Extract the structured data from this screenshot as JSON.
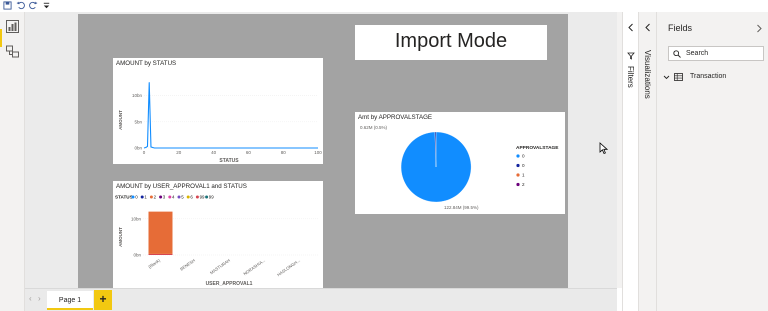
{
  "quick_access": {
    "items": [
      "save-icon",
      "undo-icon",
      "redo-icon",
      "customize-icon"
    ]
  },
  "rail": {
    "items": [
      "report-view-icon",
      "model-view-icon"
    ]
  },
  "report": {
    "title": "Import Mode",
    "chart1": {
      "title": "AMOUNT by STATUS",
      "xlabel": "STATUS",
      "ylabel": "AMOUNT",
      "y_ticks": [
        "10bn",
        "5bn",
        "0bn"
      ],
      "x_ticks": [
        "0",
        "20",
        "40",
        "60",
        "80",
        "100"
      ]
    },
    "chart2": {
      "title": "Amt by APPROVALSTAGE",
      "label_top": "0.62M (0.5%)",
      "label_bottom": "122.84M (99.5%)",
      "legend_title": "APPROVALSTAGE",
      "legend": [
        "0",
        "0",
        "1",
        "2"
      ]
    },
    "chart3": {
      "title": "AMOUNT by USER_APPROVAL1 and STATUS",
      "legend_title": "STATUS",
      "legend": [
        "0",
        "1",
        "2",
        "3",
        "4",
        "5",
        "6",
        "99",
        "99"
      ],
      "xlabel": "USER_APPROVAL1",
      "ylabel": "AMOUNT",
      "y_ticks": [
        "10bn",
        "0bn"
      ],
      "x_ticks": [
        "(Blank)",
        "BENESH",
        "MASTURAH",
        "NORASHIA...",
        "HASLONGH..."
      ]
    }
  },
  "chart_data": [
    {
      "type": "line",
      "title": "AMOUNT by STATUS",
      "xlabel": "STATUS",
      "ylabel": "AMOUNT",
      "x": [
        0,
        1,
        2,
        3,
        4,
        5,
        6,
        100
      ],
      "values": [
        0,
        0.1,
        0.3,
        12.5,
        0.2,
        0.1,
        0,
        0
      ],
      "xlim": [
        0,
        100
      ],
      "ylim": [
        0,
        13
      ],
      "y_unit": "bn"
    },
    {
      "type": "pie",
      "title": "Amt by APPROVALSTAGE",
      "categories": [
        "0",
        "0",
        "1",
        "2"
      ],
      "values": [
        122.84,
        0.62,
        0,
        0
      ],
      "unit": "M",
      "legend_position": "right"
    },
    {
      "type": "bar",
      "title": "AMOUNT by USER_APPROVAL1 and STATUS",
      "xlabel": "USER_APPROVAL1",
      "ylabel": "AMOUNT",
      "categories": [
        "(Blank)",
        "BENESH",
        "MASTURAH",
        "NORASHIA...",
        "HASLONGH..."
      ],
      "series": [
        {
          "name": "0",
          "values": [
            0.3,
            0,
            0,
            0,
            0
          ]
        },
        {
          "name": "1",
          "values": [
            11.7,
            0,
            0,
            0,
            0
          ]
        }
      ],
      "ylim": [
        0,
        13
      ],
      "y_unit": "bn"
    }
  ],
  "colors": {
    "series": [
      "#118dff",
      "#12239e",
      "#e66c37",
      "#6b007b",
      "#e044a7",
      "#744ec2",
      "#d9b300",
      "#d64550",
      "#197278"
    ],
    "accent": "#f2c811"
  },
  "tabs": {
    "page": "Page 1",
    "add": "+"
  },
  "panes": {
    "filters": "Filters",
    "visualizations": "Visualizations",
    "fields": {
      "title": "Fields",
      "search_placeholder": "Search",
      "tables": [
        "Transaction"
      ]
    }
  }
}
